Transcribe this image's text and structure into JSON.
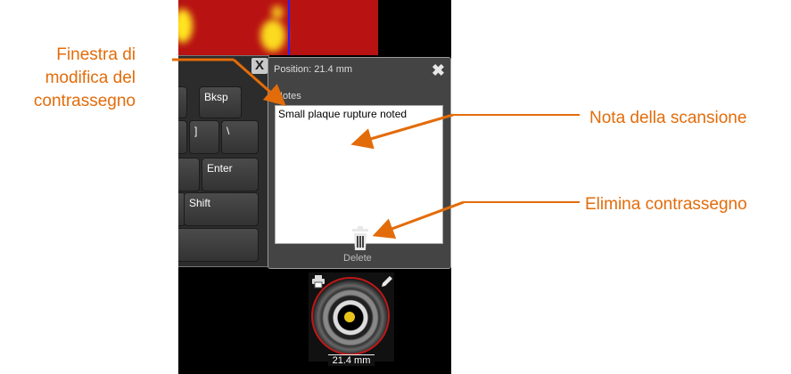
{
  "callouts": {
    "edit_window": "Finestra di modifica del contrassegno",
    "scan_note": "Nota della scansione",
    "delete_marker": "Elimina contrassegno"
  },
  "keyboard": {
    "keys": [
      "Bksp",
      "]",
      "\\",
      "Enter",
      "Shift"
    ],
    "close_label": "X"
  },
  "edit_window": {
    "position_label": "Position: 21.4 mm",
    "close_label": "✖",
    "notes_label": "Notes",
    "notes_value": "Small plaque rupture noted",
    "delete_label": "Delete"
  },
  "thumbnail": {
    "distance_label": "21.4 mm"
  },
  "colors": {
    "accent": "#e36c0a",
    "panel": "#444444",
    "heatmap_red": "#b81212",
    "heatmap_yellow": "#ffe520"
  },
  "icons": [
    "close-icon",
    "trash-icon",
    "print-icon",
    "pencil-icon"
  ]
}
